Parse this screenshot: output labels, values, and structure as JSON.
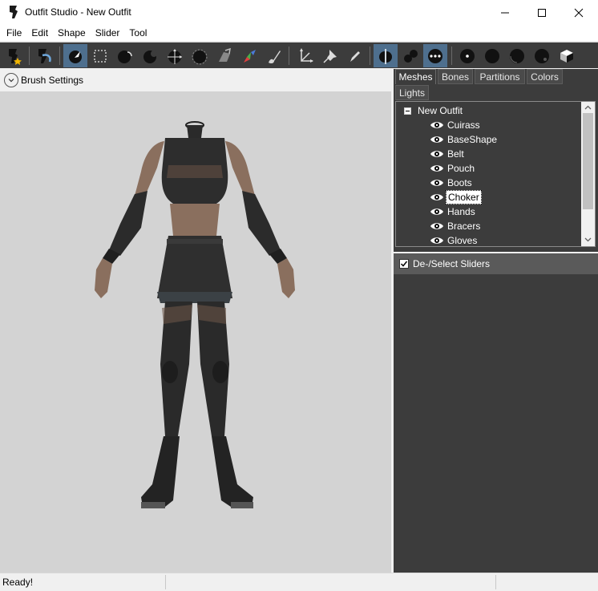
{
  "window": {
    "title": "Outfit Studio - New Outfit",
    "controls": [
      "minimize-icon",
      "maximize-icon",
      "close-icon"
    ]
  },
  "menu": [
    "File",
    "Edit",
    "Shape",
    "Slider",
    "Tool"
  ],
  "toolbar": {
    "tools": [
      "new-project-icon",
      "load-project-icon",
      "select-brush-icon",
      "mask-brush-icon",
      "inflate-brush-icon",
      "deflate-brush-icon",
      "move-brush-icon",
      "smooth-brush-icon",
      "undiff-brush-icon",
      "weight-brush-icon",
      "color-brush-icon",
      "alpha-brush-icon",
      "transform-icon",
      "pivot-icon",
      "edit-pin-icon",
      "x-mirror-icon",
      "connected-only-icon",
      "global-brush-icon",
      "vertex-dots-icon",
      "solid-sphere-icon",
      "half-sphere-icon",
      "wire-sphere-icon",
      "texture-cube-icon"
    ],
    "active": [
      "select-brush-icon",
      "x-mirror-icon",
      "global-brush-icon"
    ]
  },
  "brush_settings": {
    "label": "Brush Settings",
    "icon": "chevron-down-icon"
  },
  "tabs": {
    "items": [
      "Meshes",
      "Bones",
      "Partitions",
      "Colors",
      "Lights"
    ],
    "active": "Meshes"
  },
  "meshes": {
    "root": "New Outfit",
    "items": [
      "Cuirass",
      "BaseShape",
      "Belt",
      "Pouch",
      "Boots",
      "Choker",
      "Hands",
      "Bracers",
      "Gloves"
    ],
    "selected": "Choker",
    "icon": "eye-icon"
  },
  "sliders": {
    "label": "De-/Select Sliders",
    "checked": true
  },
  "status": {
    "text": "Ready!"
  },
  "colors": {
    "panel": "#3c3c3c",
    "viewport": "#d3d3d3",
    "active_tool": "#4e6f8e"
  }
}
